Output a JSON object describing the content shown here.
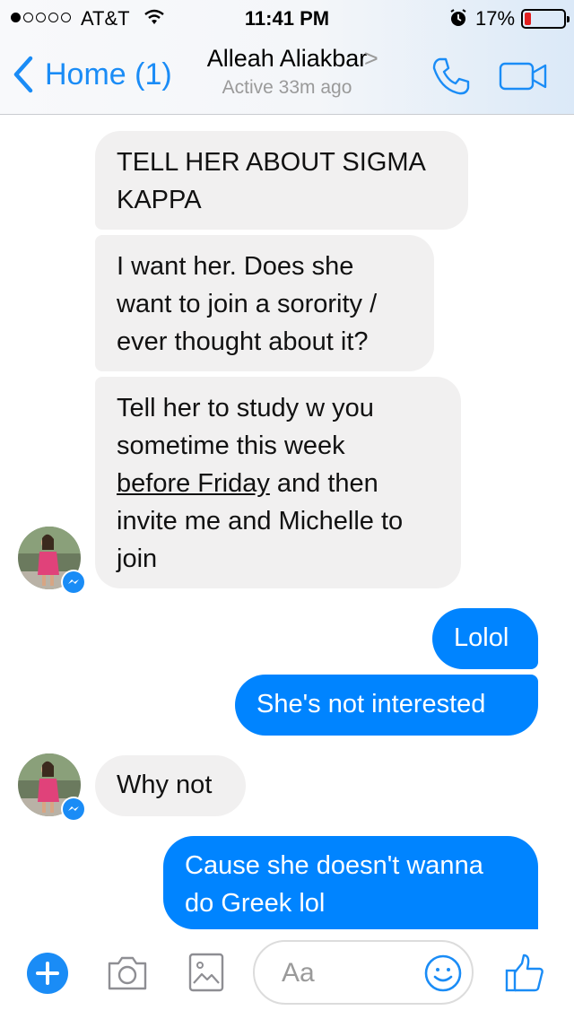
{
  "status_bar": {
    "carrier": "AT&T",
    "time": "11:41 PM",
    "battery_percent_text": "17%",
    "battery_level": 0.17,
    "signal_bars_filled": 1,
    "signal_bars_total": 5
  },
  "header": {
    "back_label": "Home (1)",
    "contact_name": "Alleah Aliakbar",
    "chevron": ">",
    "active_status": "Active 33m ago"
  },
  "messages": [
    {
      "direction": "incoming",
      "lines": [
        "TELL HER ABOUT SIGMA",
        "KAPPA"
      ]
    },
    {
      "direction": "incoming",
      "lines": [
        "I want her. Does she",
        "want to join a sorority /",
        "ever thought about it?"
      ]
    },
    {
      "direction": "incoming",
      "lines": [
        "Tell her to study w you",
        "sometime this week"
      ],
      "link_text": "before Friday",
      "after_link": " and then",
      "more_lines": [
        "invite me and Michelle to",
        "join"
      ]
    },
    {
      "direction": "outgoing",
      "lines": [
        "Lolol"
      ]
    },
    {
      "direction": "outgoing",
      "lines": [
        "She's not interested"
      ]
    },
    {
      "direction": "incoming",
      "lines": [
        "Why not"
      ]
    },
    {
      "direction": "outgoing",
      "lines": [
        "Cause she doesn't wanna",
        "do Greek lol"
      ]
    }
  ],
  "composer": {
    "placeholder": "Aa"
  },
  "colors": {
    "accent": "#1a8cf6",
    "outgoing_bubble": "#0084ff",
    "incoming_bubble": "#f1f0f0",
    "battery_low": "#e02020"
  }
}
